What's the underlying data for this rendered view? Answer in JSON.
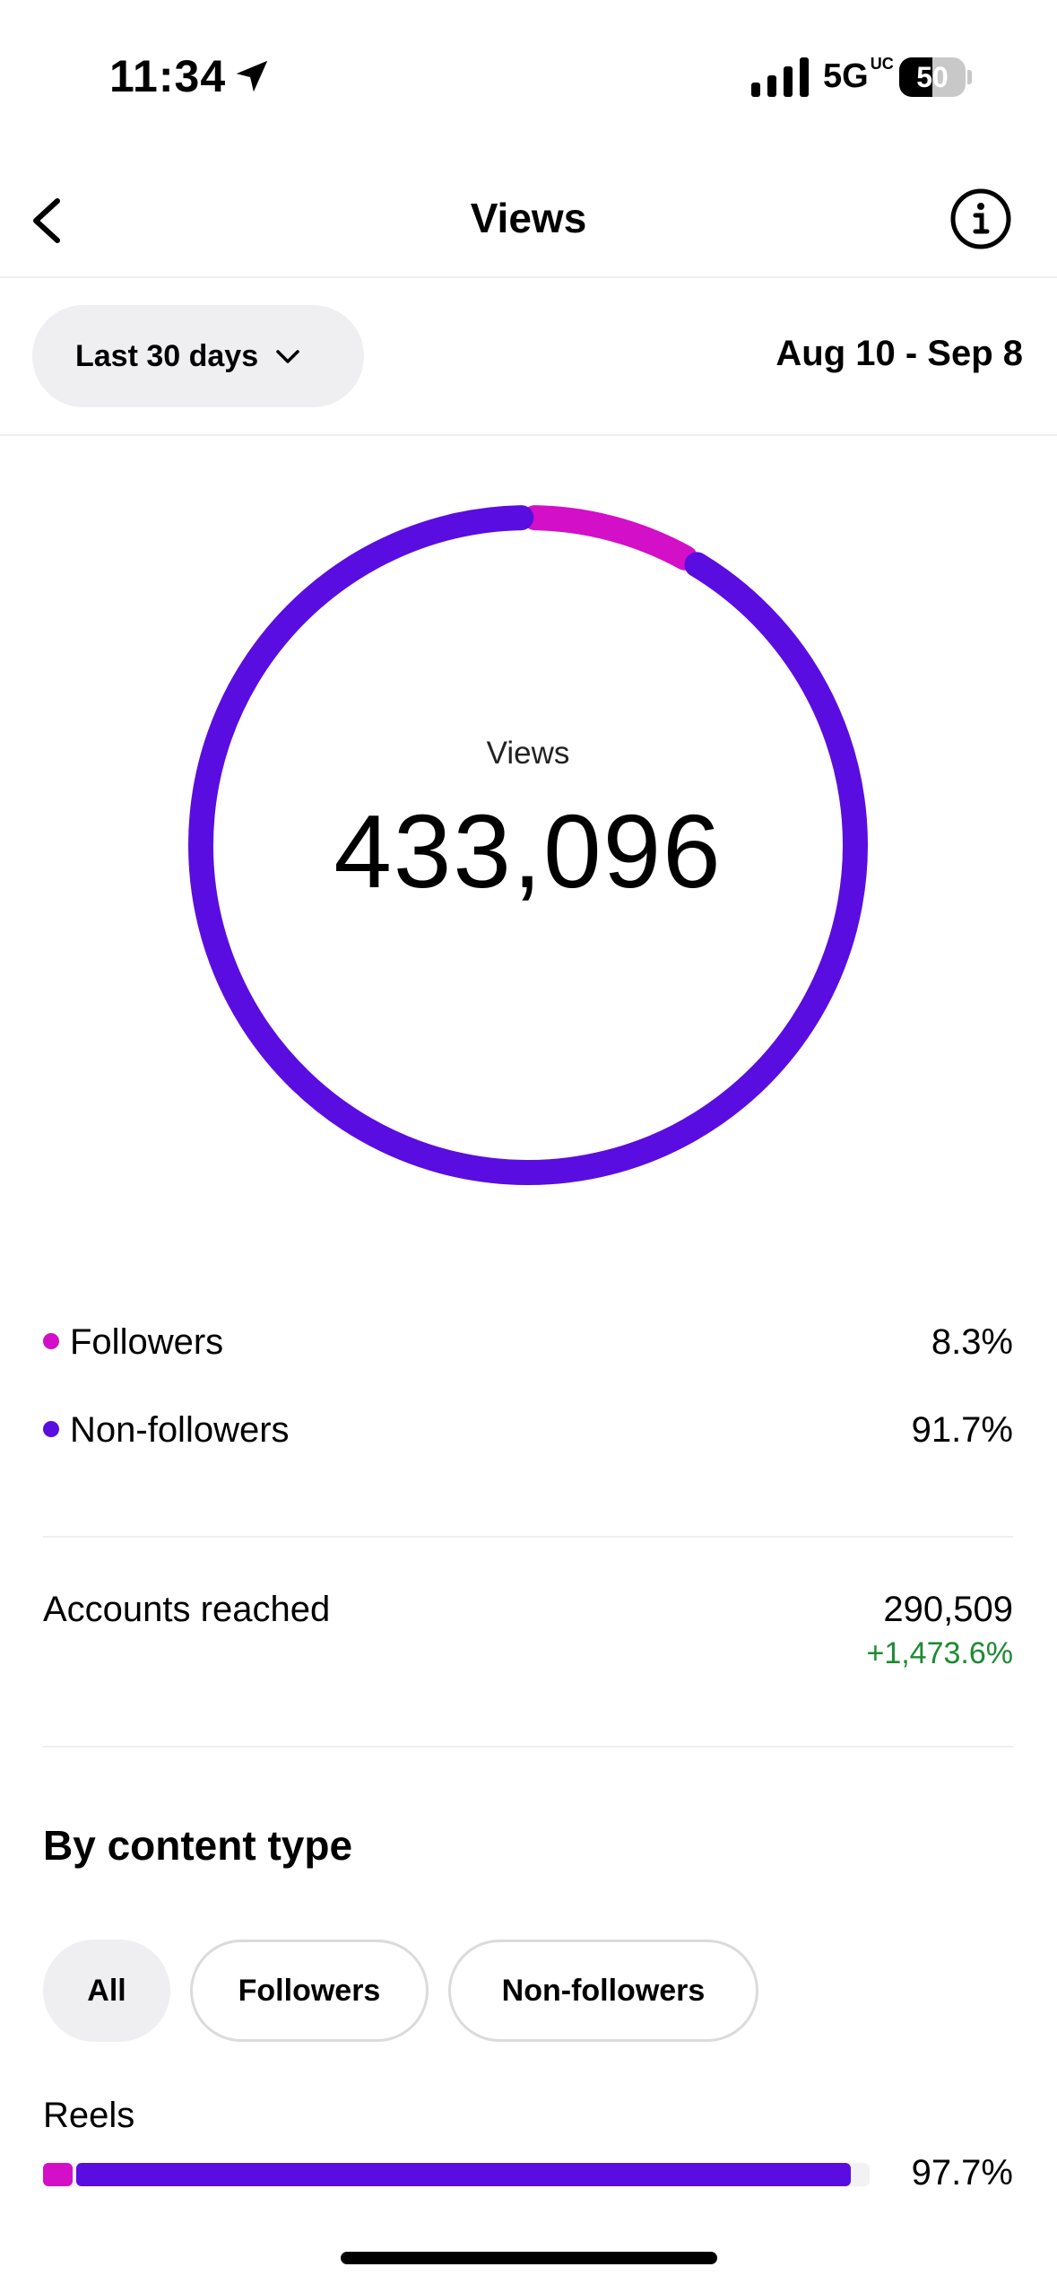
{
  "status_bar": {
    "time": "11:34",
    "network": "5G",
    "network_suffix": "UC",
    "battery": "50",
    "battery_level": 0.5
  },
  "header": {
    "title": "Views",
    "back_icon": "chevron-left-icon",
    "info_icon": "info-circle-icon"
  },
  "filter": {
    "range_label": "Last 30 days",
    "date_range": "Aug 10 - Sep 8"
  },
  "summary": {
    "caption": "Views",
    "total": "433,096"
  },
  "chart_data": {
    "type": "pie",
    "title": "",
    "categories": [
      "Followers",
      "Non-followers"
    ],
    "values": [
      8.3,
      91.7
    ],
    "colors": [
      "#d30fc7",
      "#5a0de0"
    ]
  },
  "legend": {
    "items": [
      {
        "label": "Followers",
        "value": "8.3%",
        "color": "#d30fc7"
      },
      {
        "label": "Non-followers",
        "value": "91.7%",
        "color": "#5a0de0"
      }
    ]
  },
  "reach": {
    "label": "Accounts reached",
    "value": "290,509",
    "change": "+1,473.6%"
  },
  "content_type": {
    "title": "By content type",
    "chips": [
      "All",
      "Followers",
      "Non-followers"
    ],
    "selected": "All"
  },
  "reels": {
    "label": "Reels",
    "value": "97.7%",
    "total_fraction": 0.977,
    "followers_fraction": 0.036,
    "non_followers_fraction": 0.941
  },
  "colors": {
    "followers": "#d30fc7",
    "non_followers": "#5a0de0",
    "positive": "#1e8a32"
  }
}
